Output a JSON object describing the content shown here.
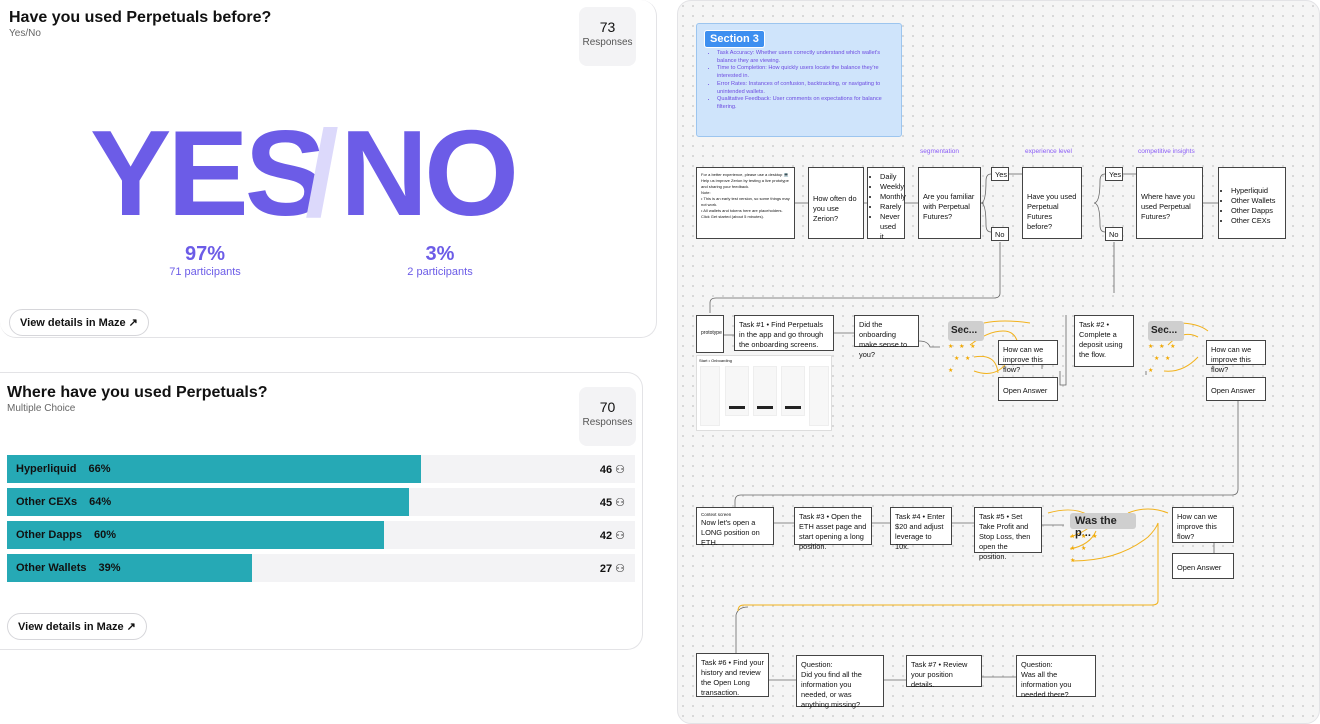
{
  "card1": {
    "title": "Have you used Perpetuals before?",
    "subtitle": "Yes/No",
    "responses_count": "73",
    "responses_label": "Responses",
    "yes_text": "YES",
    "slash_text": "/",
    "no_text": "NO",
    "yes_pct": "97%",
    "yes_participants": "71 participants",
    "no_pct": "3%",
    "no_participants": "2 participants",
    "maze_button": "View details in Maze ↗"
  },
  "card2": {
    "title": "Where have you used Perpetuals?",
    "subtitle": "Multiple Choice",
    "responses_count": "70",
    "responses_label": "Responses",
    "bars": [
      {
        "label": "Hyperliquid",
        "pct": "66%",
        "count": "46",
        "fraction": 0.66
      },
      {
        "label": "Other CEXs",
        "pct": "64%",
        "count": "45",
        "fraction": 0.64
      },
      {
        "label": "Other Dapps",
        "pct": "60%",
        "count": "42",
        "fraction": 0.6
      },
      {
        "label": "Other Wallets",
        "pct": "39%",
        "count": "27",
        "fraction": 0.39
      }
    ],
    "maze_button": "View details in Maze ↗"
  },
  "flow": {
    "section_title": "Section 3",
    "section_items": [
      "Task Accuracy: Whether users correctly understand which wallet's balance they are viewing.",
      "Time to Completion: How quickly users locate the balance they're interested in.",
      "Error Rates: Instances of confusion, backtracking, or navigating to unintended wallets.",
      "Qualitative Feedback: User comments on expectations for balance filtering."
    ],
    "labels": {
      "segmentation": "segmentation",
      "experience": "experience level",
      "competitive": "competitive insights"
    },
    "intro_text": "For a better experience, please use a desktop 💻\nHelp us improve Zerion by testing a live prototype and sharing your feedback.\nNote:\n• This is an early test version, so some things may not work.\n• All wallets and tokens here are placeholders.\nClick Get started (about 5 minutes).",
    "q_often": "How often do you use Zerion?",
    "freq_list": [
      "Daily",
      "Weekly",
      "Monthly",
      "Rarely",
      "Never used it"
    ],
    "q_familiar": "Are you familiar with Perpetual Futures?",
    "yes": "Yes",
    "no": "No",
    "q_used": "Have you used Perpetual Futures before?",
    "q_where": "Where have you used Perpetual Futures?",
    "where_list": [
      "Hyperliquid",
      "Other Wallets",
      "Other Dapps",
      "Other CEXs"
    ],
    "prototype": "prototype",
    "task1": "Task #1 • Find Perpetuals in the app and go through the onboarding screens.",
    "q_onboarding": "Did the onboarding make sense to you?",
    "sec_short": "Sec...",
    "improve": "How can we improve this flow?",
    "open_answer": "Open Answer",
    "task2": "Task #2 • Complete a deposit using the flow.",
    "screens_title": "Start • Onboarding",
    "context_label": "Context screen",
    "context_text": "Now let's open a LONG position on ETH.",
    "task3": "Task #3 • Open the ETH asset page and start opening a long position.",
    "task4": "Task #4 • Enter $20 and adjust leverage to 10x.",
    "task5": "Task #5 • Set Take Profit and Stop Loss, then open the position.",
    "was_the": "Was the p...",
    "task6": "Task #6 • Find your history and review the Open Long transaction.",
    "q_found": "Question:\nDid you find all the information you needed, or was anything missing?",
    "task7": "Task #7 • Review your position details.",
    "q_all": "Question:\nWas all the information you needed there?"
  }
}
